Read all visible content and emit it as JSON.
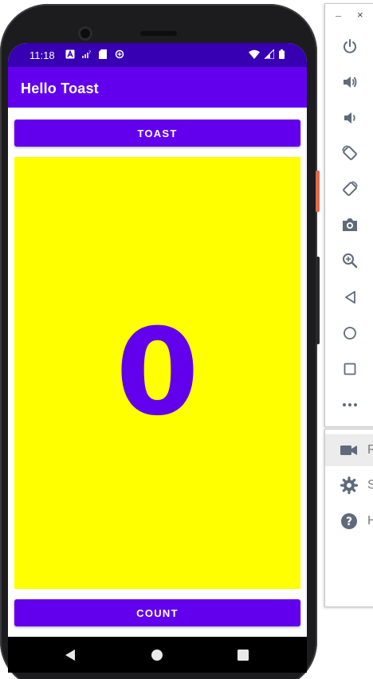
{
  "status_bar": {
    "time": "11:18"
  },
  "app_bar": {
    "title": "Hello Toast"
  },
  "buttons": {
    "toast_label": "TOAST",
    "count_label": "COUNT"
  },
  "counter": {
    "value": "0"
  },
  "colors": {
    "status_bar": "#3700b3",
    "primary": "#6200ee",
    "count_panel": "#ffff00"
  },
  "icons": {
    "status": [
      "a-notification-icon",
      "signal-question-icon",
      "sd-card-icon",
      "data-saver-icon",
      "wifi-icon",
      "cell-signal-icon",
      "battery-icon"
    ],
    "navigation": [
      "back-icon",
      "home-icon",
      "recents-icon"
    ],
    "emulator_toolbar": [
      "power-icon",
      "volume-up-icon",
      "volume-down-icon",
      "rotate-left-icon",
      "rotate-right-icon",
      "camera-icon",
      "zoom-icon",
      "back-icon",
      "home-icon",
      "overview-icon",
      "more-icon"
    ],
    "extended_controls": [
      "record-icon",
      "settings-icon",
      "help-icon"
    ]
  },
  "extended_controls": {
    "record_label": "R",
    "settings_label": "S",
    "help_label": "H"
  },
  "toolbar": {
    "minimize_label": "–",
    "close_label": "×"
  }
}
